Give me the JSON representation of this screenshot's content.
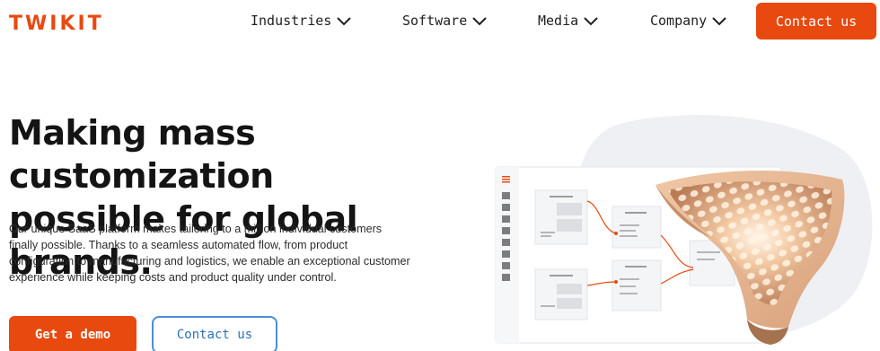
{
  "brand": {
    "logo": "TWIKIT",
    "accent": "#e8490f",
    "link": "#2c6fb5"
  },
  "nav": {
    "items": [
      {
        "label": "Industries"
      },
      {
        "label": "Software"
      },
      {
        "label": "Media"
      },
      {
        "label": "Company"
      }
    ],
    "contact_label": "Contact us"
  },
  "hero": {
    "title_line1": "Making mass customization",
    "title_line2": "possible for global brands.",
    "description": "Our unique SaaS platform makes tailoring to a million individual customers finally possible. Thanks to a seamless automated flow, from product configuration to manufacturing and logistics, we enable an exceptional customer experience while keeping costs and product quality under control.",
    "demo_label": "Get a demo",
    "contact_label": "Contact us"
  },
  "icons": {
    "nav_chevron": "chevron-down-icon",
    "menu": "hamburger-icon"
  }
}
